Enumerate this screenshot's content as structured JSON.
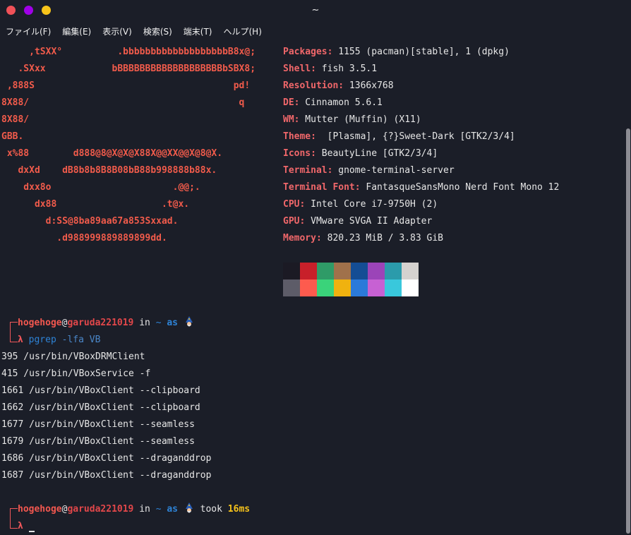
{
  "window": {
    "title": "~"
  },
  "menu": [
    "ファイル(F)",
    "編集(E)",
    "表示(V)",
    "検索(S)",
    "端末(T)",
    "ヘルプ(H)"
  ],
  "logo": [
    "     ,tSXX°          .bbbbbbbbbbbbbbbbbbbB8x@;",
    "   .SXxx            bBBBBBBBBBBBBBBBBBBBbSBX8;",
    " ,888S                                    pd!",
    "8X88/                                      q",
    "8X88/",
    "GBB.",
    " x%88        d888@8@X@X@X88X@@XX@@X@8@X.",
    "   dxXd    dB8b8b8B8B08bB88b998888b88x.",
    "    dxx8o                      .@@;.",
    "      dx88                   .t@x.",
    "        d:SS@8ba89aa67a853Sxxad.",
    "          .d988999889889899dd."
  ],
  "info": [
    {
      "key": "Packages",
      "value": " 1155 (pacman)[stable], 1 (dpkg)"
    },
    {
      "key": "Shell",
      "value": " fish 3.5.1"
    },
    {
      "key": "Resolution",
      "value": " 1366x768"
    },
    {
      "key": "DE",
      "value": " Cinnamon 5.6.1"
    },
    {
      "key": "WM",
      "value": " Mutter (Muffin) (X11)"
    },
    {
      "key": "Theme",
      "value": "  [Plasma], {?}Sweet-Dark [GTK2/3/4]"
    },
    {
      "key": "Icons",
      "value": " BeautyLine [GTK2/3/4]"
    },
    {
      "key": "Terminal",
      "value": " gnome-terminal-server"
    },
    {
      "key": "Terminal Font",
      "value": " FantasqueSansMono Nerd Font Mono 12"
    },
    {
      "key": "CPU",
      "value": " Intel Core i7-9750H (2)"
    },
    {
      "key": "GPU",
      "value": " VMware SVGA II Adapter"
    },
    {
      "key": "Memory",
      "value": " 820.23 MiB / 3.83 GiB"
    }
  ],
  "palette": {
    "top": [
      "#1b1a24",
      "#c8202a",
      "#2f9b67",
      "#a0714b",
      "#144d94",
      "#9b44b8",
      "#2b9bab",
      "#d5d2cf"
    ],
    "bottom": [
      "#5d5c68",
      "#fd5b4e",
      "#3ad37a",
      "#f0b20f",
      "#2b7ad9",
      "#c761d3",
      "#39c8dc",
      "#ffffff"
    ]
  },
  "prompt1": {
    "user": "hogehoge",
    "at": "@",
    "host": "garuda221019",
    "in": " in ",
    "dir": "~",
    "as": " as ",
    "lambda": "λ",
    "cmd": "pgrep",
    "args": " -lfa VB"
  },
  "output": [
    "395 /usr/bin/VBoxDRMClient",
    "415 /usr/bin/VBoxService -f",
    "1661 /usr/bin/VBoxClient --clipboard",
    "1662 /usr/bin/VBoxClient --clipboard",
    "1677 /usr/bin/VBoxClient --seamless",
    "1679 /usr/bin/VBoxClient --seamless",
    "1686 /usr/bin/VBoxClient --draganddrop",
    "1687 /usr/bin/VBoxClient --draganddrop"
  ],
  "prompt2": {
    "user": "hogehoge",
    "at": "@",
    "host": "garuda221019",
    "in": " in ",
    "dir": "~",
    "as": " as ",
    "took": " took ",
    "time": "16ms",
    "lambda": "λ"
  },
  "icons": {
    "wizard": "wizard-icon"
  }
}
